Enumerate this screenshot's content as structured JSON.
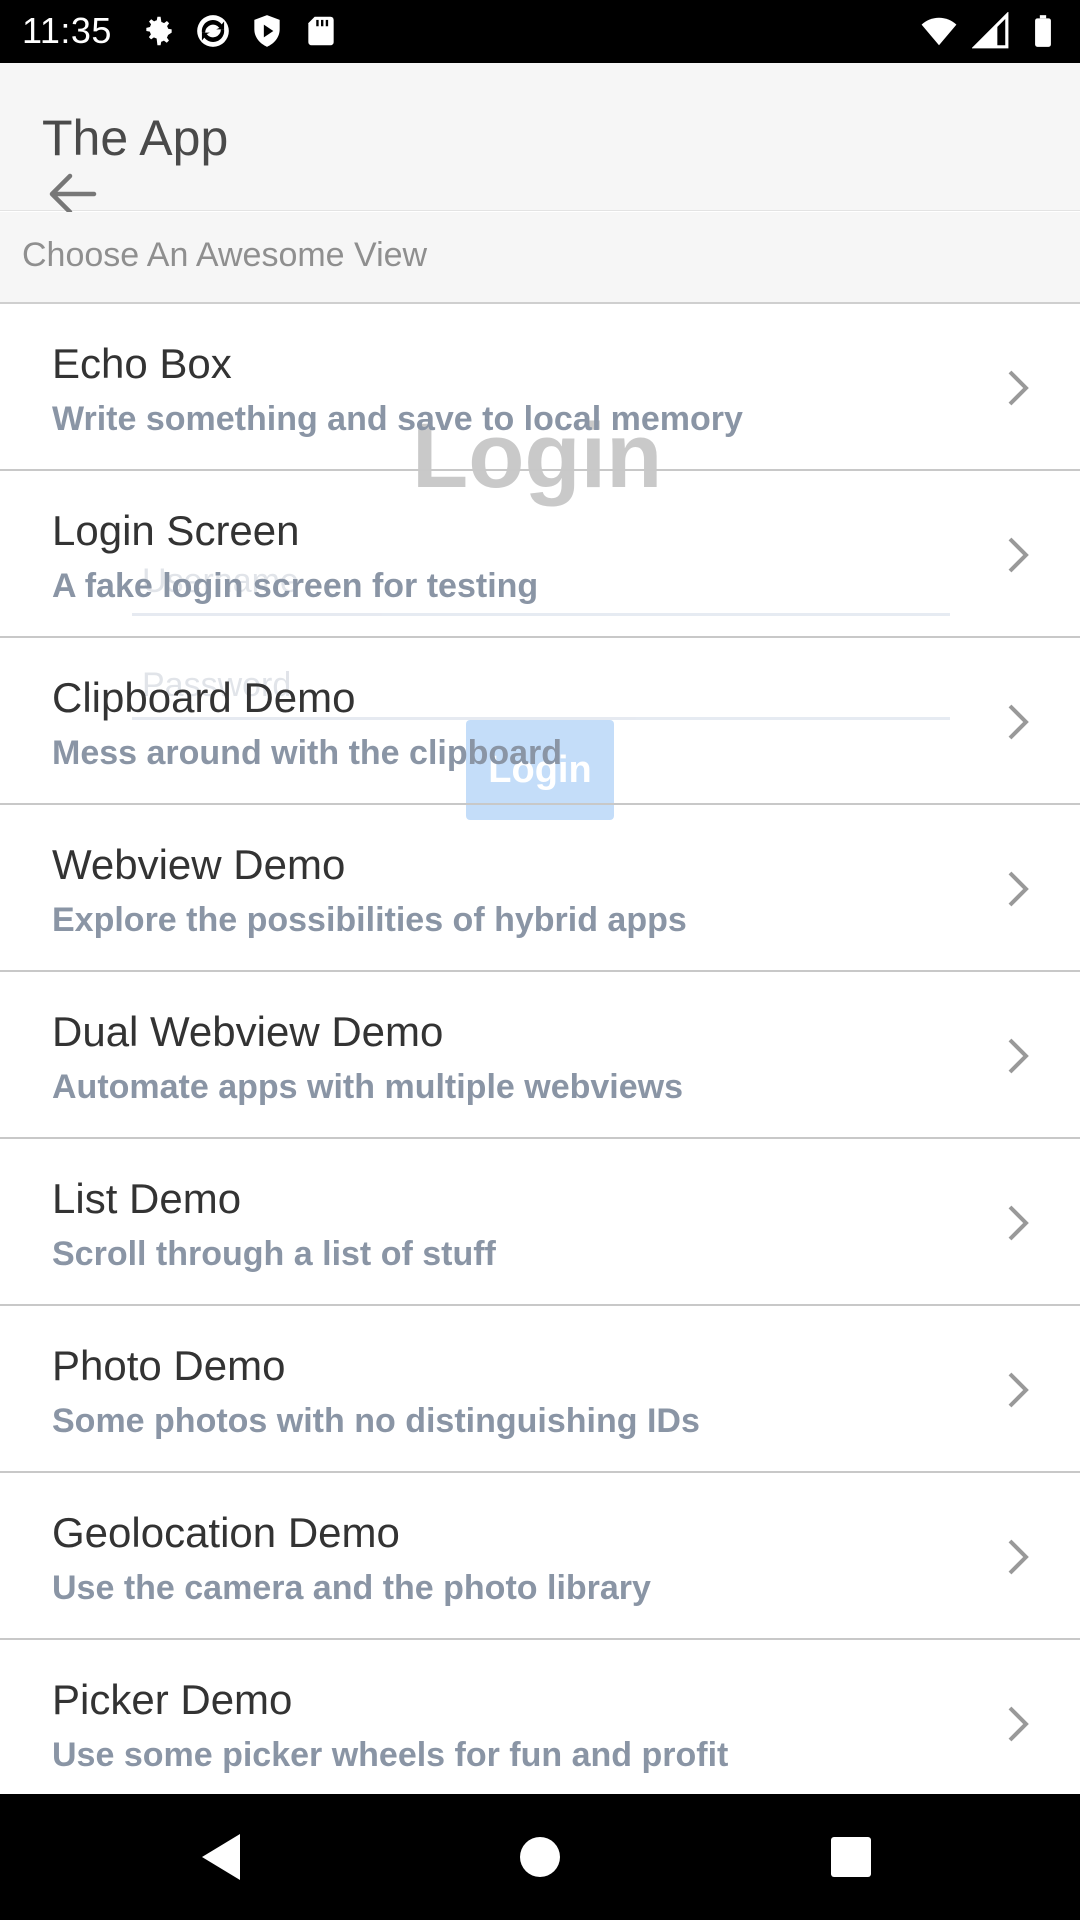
{
  "status_bar": {
    "time": "11:35",
    "left_icons": [
      "gear-icon",
      "sync-icon",
      "play-shield-icon",
      "sd-card-icon"
    ],
    "right_icons": [
      "wifi-icon",
      "signal-icon",
      "battery-icon"
    ]
  },
  "header": {
    "title": "The App",
    "subtitle": "Choose An Awesome View"
  },
  "background_overlay": {
    "title": "Login",
    "username_placeholder": "Username",
    "password_placeholder": "Password",
    "button_label": "Login"
  },
  "list": [
    {
      "title": "Echo Box",
      "description": "Write something and save to local memory"
    },
    {
      "title": "Login Screen",
      "description": "A fake login screen for testing"
    },
    {
      "title": "Clipboard Demo",
      "description": "Mess around with the clipboard"
    },
    {
      "title": "Webview Demo",
      "description": "Explore the possibilities of hybrid apps"
    },
    {
      "title": "Dual Webview Demo",
      "description": "Automate apps with multiple webviews"
    },
    {
      "title": "List Demo",
      "description": "Scroll through a list of stuff"
    },
    {
      "title": "Photo Demo",
      "description": "Some photos with no distinguishing IDs"
    },
    {
      "title": "Geolocation Demo",
      "description": "Use the camera and the photo library"
    },
    {
      "title": "Picker Demo",
      "description": "Use some picker wheels for fun and profit"
    }
  ],
  "colors": {
    "header_bg": "#f6f6f6",
    "desc_text": "#8a95a5",
    "divider": "#c8c8c8",
    "login_button": "#5aa1ef"
  },
  "nav_bar": {
    "icons": [
      "back-triangle-icon",
      "home-circle-icon",
      "recents-square-icon"
    ]
  }
}
